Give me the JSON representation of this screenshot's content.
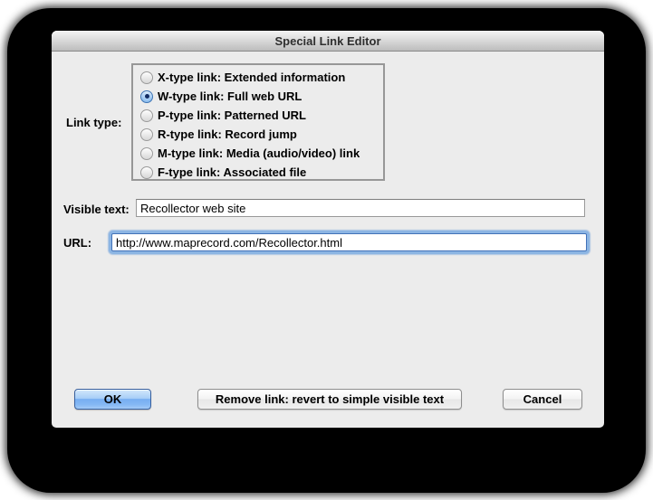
{
  "window": {
    "title": "Special Link Editor"
  },
  "link_type": {
    "label": "Link type:",
    "options": [
      {
        "label": "X-type link: Extended information",
        "selected": false
      },
      {
        "label": "W-type link: Full web URL",
        "selected": true
      },
      {
        "label": "P-type link: Patterned URL",
        "selected": false
      },
      {
        "label": "R-type link: Record jump",
        "selected": false
      },
      {
        "label": "M-type link: Media (audio/video) link",
        "selected": false
      },
      {
        "label": "F-type link: Associated file",
        "selected": false
      }
    ]
  },
  "visible_text_field": {
    "label": "Visible text:",
    "value": "Recollector web site"
  },
  "url_field": {
    "label": "URL:",
    "value": "http://www.maprecord.com/Recollector.html",
    "focused": true
  },
  "buttons": {
    "ok": "OK",
    "remove": "Remove link: revert to simple visible text",
    "cancel": "Cancel"
  },
  "colors": {
    "body_bg": "#ececec",
    "selected_radio_blue": "#7db2e8",
    "radio_dot_navy": "#122c63",
    "focus_ring_blue": "#8cb5e3",
    "default_button_blue": "#84b7f4"
  }
}
